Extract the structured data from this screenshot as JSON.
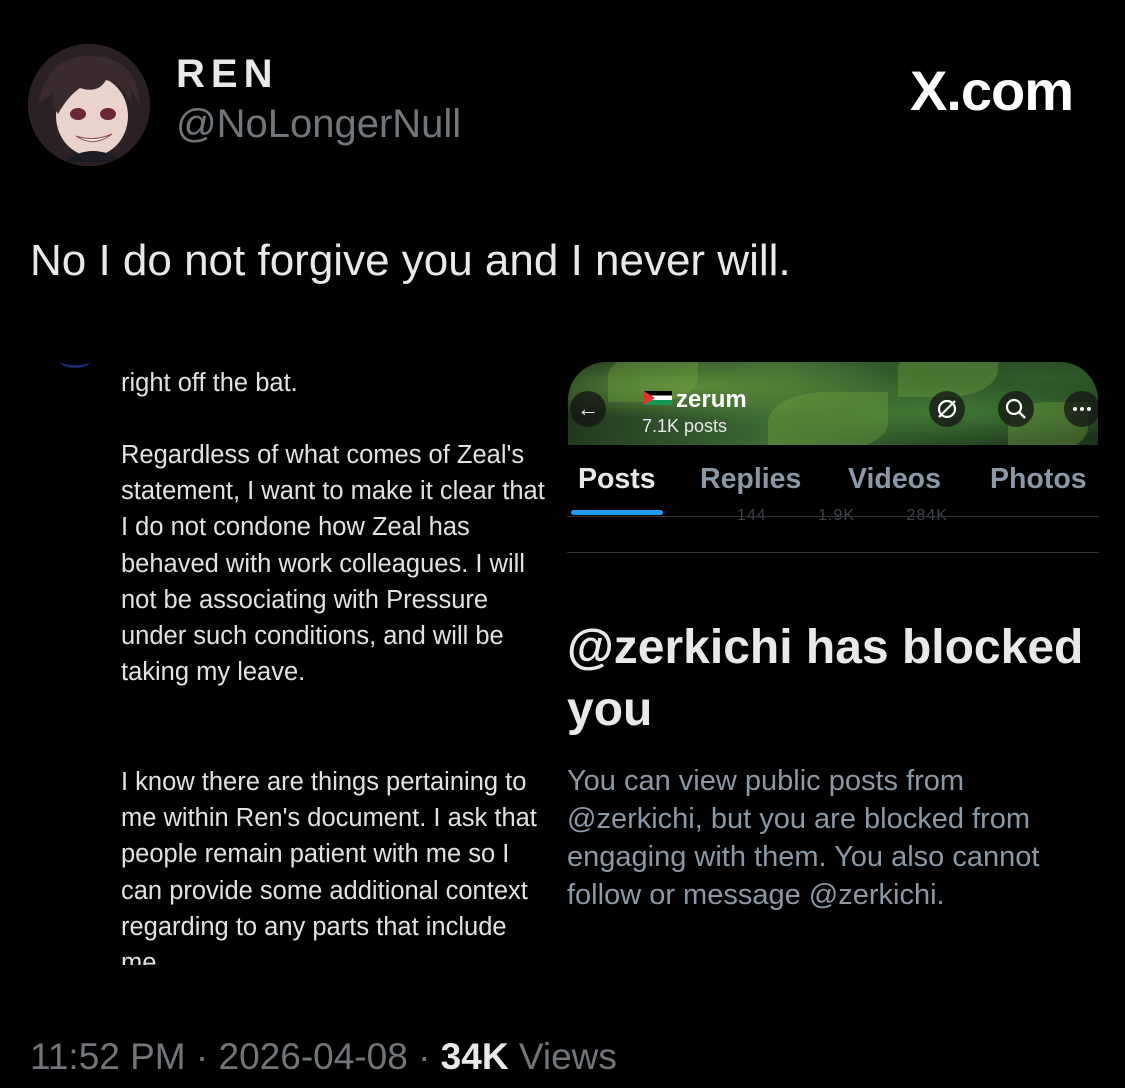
{
  "author": {
    "display_name": "REN",
    "handle": "@NoLongerNull",
    "avatar": "avatar-anime-character"
  },
  "site_logo": "X.com",
  "tweet": {
    "text": "No I do not forgive you and I never will."
  },
  "left_screenshot": {
    "paragraph_1": "right off the bat.",
    "paragraph_2": "Regardless of what comes of Zeal's statement, I want to make it clear that I do not condone how Zeal has behaved with work colleagues. I will not be associating with Pressure under such conditions, and will be taking my leave.",
    "paragraph_3": "I know there are things pertaining to me within Ren's document. I ask that people remain patient with me so I can provide some additional context regarding to any parts that include me."
  },
  "right_screenshot": {
    "back_icon": "arrow-left-icon",
    "profile_flag_icon": "palestine-flag-icon",
    "profile_name": "zerum",
    "post_count": "7.1K posts",
    "icons": [
      "mute-icon",
      "search-icon",
      "more-icon"
    ],
    "tabs": [
      "Posts",
      "Replies",
      "Videos",
      "Photos"
    ],
    "active_tab": "Posts",
    "ghost_stats": [
      "144",
      "1.9K",
      "284K"
    ],
    "blocked_title": "@zerkichi has blocked you",
    "blocked_body": "You can view public posts from @zerkichi, but you are blocked from engaging with them. You also cannot follow or message @zerkichi."
  },
  "meta": {
    "time": "11:52 PM",
    "separator": "·",
    "date": "2026-04-08",
    "views_count": "34K",
    "views_label": "Views"
  },
  "colors": {
    "background": "#000000",
    "accent": "#1d9bf0",
    "muted": "#71767b"
  }
}
